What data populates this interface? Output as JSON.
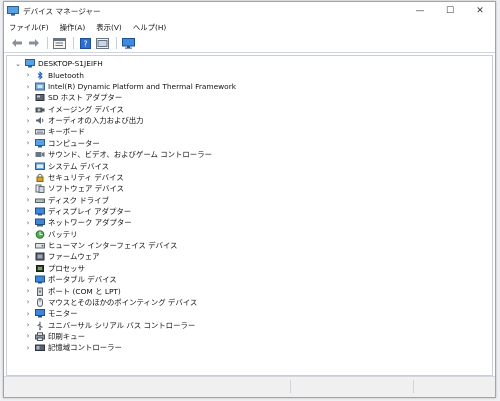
{
  "window": {
    "title": "デバイス マネージャー",
    "controls": {
      "minimize": "—",
      "maximize": "☐",
      "close": "✕"
    }
  },
  "menu": [
    {
      "label": "ファイル(F)"
    },
    {
      "label": "操作(A)"
    },
    {
      "label": "表示(V)"
    },
    {
      "label": "ヘルプ(H)"
    }
  ],
  "toolbar": {
    "icons": [
      "back-arrow-icon",
      "forward-arrow-icon",
      "properties-icon",
      "help-icon",
      "action-icon",
      "monitor-scan-icon"
    ]
  },
  "tree": {
    "root": {
      "label": "DESKTOP-S1JEIFH",
      "expanded": true
    },
    "categories": [
      {
        "label": "Bluetooth",
        "icon": "bluetooth-icon"
      },
      {
        "label": "Intel(R) Dynamic Platform and Thermal Framework",
        "icon": "intel-framework-icon"
      },
      {
        "label": "SD ホスト アダプター",
        "icon": "sd-host-icon"
      },
      {
        "label": "イメージング デバイス",
        "icon": "camera-icon"
      },
      {
        "label": "オーディオの入力および出力",
        "icon": "speaker-icon"
      },
      {
        "label": "キーボード",
        "icon": "keyboard-icon"
      },
      {
        "label": "コンピューター",
        "icon": "computer-icon"
      },
      {
        "label": "サウンド、ビデオ、およびゲーム コントローラー",
        "icon": "sound-video-icon"
      },
      {
        "label": "システム デバイス",
        "icon": "system-device-icon"
      },
      {
        "label": "セキュリティ デバイス",
        "icon": "security-device-icon"
      },
      {
        "label": "ソフトウェア デバイス",
        "icon": "software-device-icon"
      },
      {
        "label": "ディスク ドライブ",
        "icon": "disk-drive-icon"
      },
      {
        "label": "ディスプレイ アダプター",
        "icon": "display-adapter-icon"
      },
      {
        "label": "ネットワーク アダプター",
        "icon": "network-adapter-icon"
      },
      {
        "label": "バッテリ",
        "icon": "battery-icon"
      },
      {
        "label": "ヒューマン インターフェイス デバイス",
        "icon": "hid-icon"
      },
      {
        "label": "ファームウェア",
        "icon": "firmware-icon"
      },
      {
        "label": "プロセッサ",
        "icon": "processor-icon"
      },
      {
        "label": "ポータブル デバイス",
        "icon": "portable-device-icon"
      },
      {
        "label": "ポート (COM と LPT)",
        "icon": "port-icon"
      },
      {
        "label": "マウスとそのほかのポインティング デバイス",
        "icon": "mouse-icon"
      },
      {
        "label": "モニター",
        "icon": "monitor-icon"
      },
      {
        "label": "ユニバーサル シリアル バス コントローラー",
        "icon": "usb-icon"
      },
      {
        "label": "印刷キュー",
        "icon": "printer-icon"
      },
      {
        "label": "記憶域コントローラー",
        "icon": "storage-controller-icon"
      }
    ]
  },
  "colors": {
    "accent": "#2f7bd6",
    "frame": "#9aa6b4"
  }
}
